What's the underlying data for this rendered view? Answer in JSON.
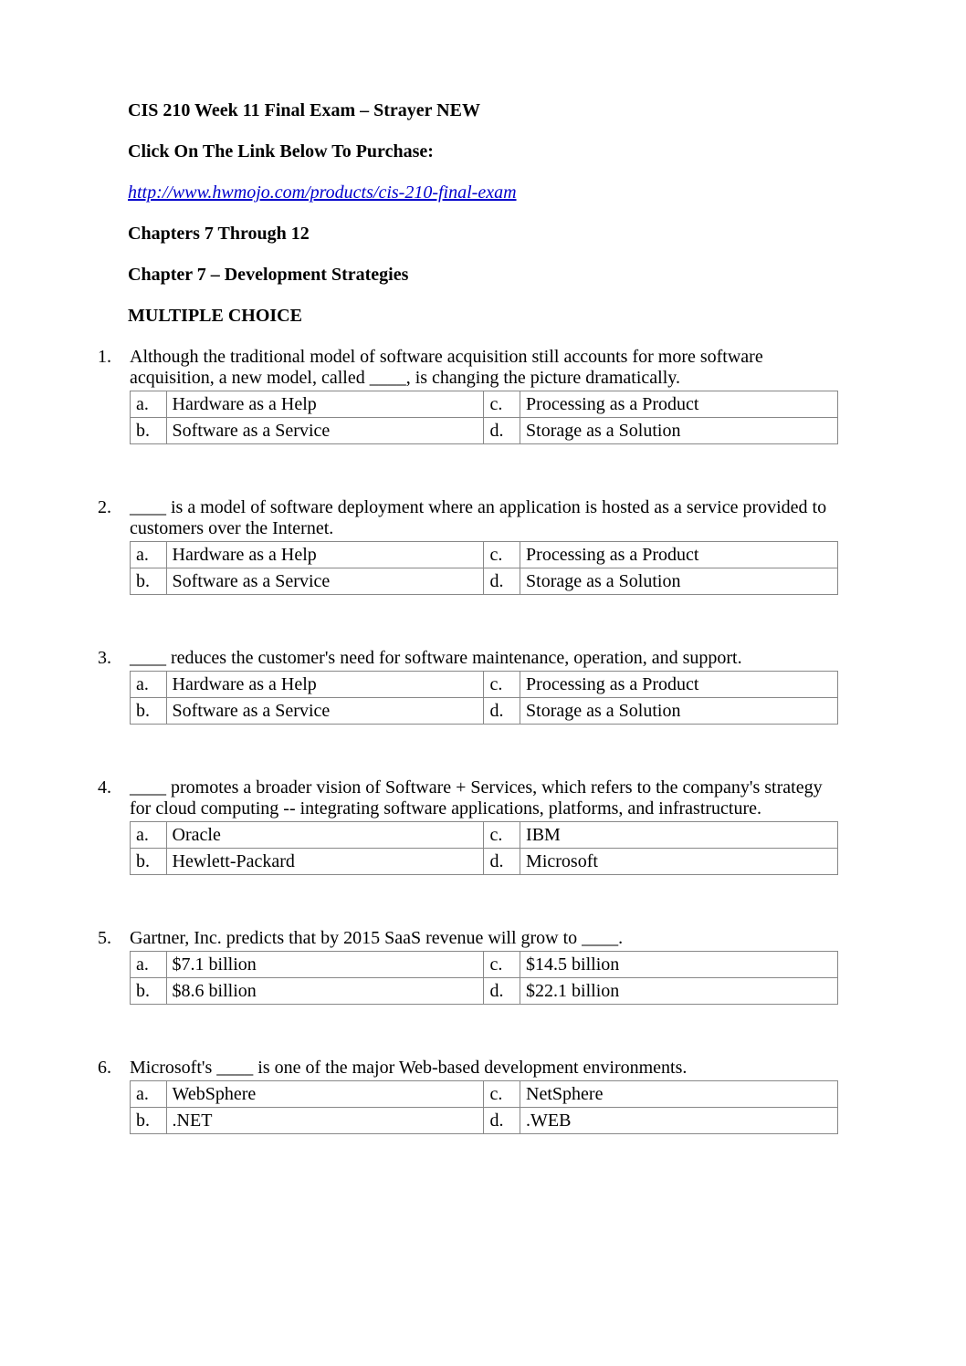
{
  "header": {
    "title": "CIS 210 Week 11 Final Exam – Strayer NEW",
    "subtitle": "Click On The Link Below To Purchase:",
    "link": "http://www.hwmojo.com/products/cis-210-final-exam",
    "chapters": "Chapters 7 Through 12",
    "chapter7": "Chapter 7 – Development Strategies",
    "mcq": "MULTIPLE CHOICE"
  },
  "questions": [
    {
      "num": "1.",
      "text": "Although the traditional model of software acquisition still accounts for more software acquisition, a new model, called ____, is changing the picture dramatically.",
      "options": {
        "a": "Hardware as a Help",
        "b": "Software as a Service",
        "c": "Processing as a Product",
        "d": "Storage as a Solution"
      }
    },
    {
      "num": "2.",
      "text": "____ is a model of software deployment where an application is hosted as a service provided to customers over the Internet.",
      "options": {
        "a": "Hardware as a Help",
        "b": "Software as a Service",
        "c": "Processing as a Product",
        "d": "Storage as a Solution"
      }
    },
    {
      "num": "3.",
      "text": "____ reduces the customer's need for software maintenance, operation, and support.",
      "options": {
        "a": "Hardware as a Help",
        "b": "Software as a Service",
        "c": "Processing as a Product",
        "d": "Storage as a Solution"
      }
    },
    {
      "num": "4.",
      "text": "____ promotes a broader vision of Software + Services, which refers to the company's strategy for cloud computing -- integrating software applications, platforms, and infrastructure.",
      "options": {
        "a": "Oracle",
        "b": "Hewlett-Packard",
        "c": "IBM",
        "d": "Microsoft"
      }
    },
    {
      "num": "5.",
      "text": "Gartner, Inc. predicts that by 2015 SaaS revenue will grow to ____.",
      "options": {
        "a": "$7.1 billion",
        "b": "$8.6 billion",
        "c": "$14.5 billion",
        "d": "$22.1 billion"
      }
    },
    {
      "num": "6.",
      "text": "Microsoft's ____ is one of the major Web-based development environments.",
      "options": {
        "a": "WebSphere",
        "b": ".NET",
        "c": "NetSphere",
        "d": ".WEB"
      }
    }
  ],
  "letters": {
    "a": "a.",
    "b": "b.",
    "c": "c.",
    "d": "d."
  }
}
